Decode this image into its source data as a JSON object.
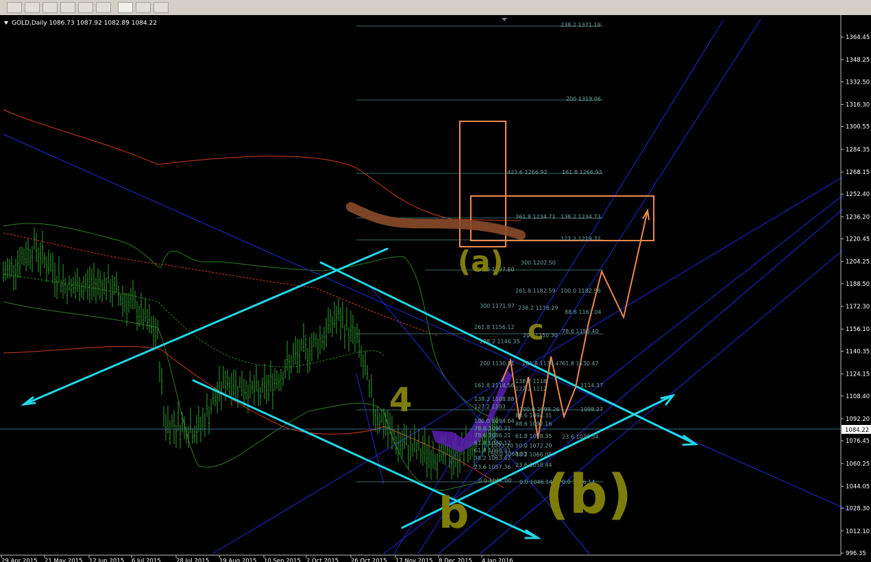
{
  "window": {
    "symbol_header": "GOLD,Daily  1086.73  1087.92  1082.89  1084.22"
  },
  "chart_data": {
    "type": "candlestick",
    "symbol": "GOLD",
    "timeframe": "Daily",
    "ohlc": {
      "open": 1086.73,
      "high": 1087.92,
      "low": 1082.89,
      "close": 1084.22
    },
    "current_price_label": "1084.22",
    "ylim": [
      996.35,
      1371.19
    ],
    "price_ticks": [
      "1364.45",
      "1348.25",
      "1332.50",
      "1316.30",
      "1300.55",
      "1284.35",
      "1268.15",
      "1252.40",
      "1236.20",
      "1220.45",
      "1204.25",
      "1188.50",
      "1172.30",
      "1156.10",
      "1140.35",
      "1124.15",
      "1108.40",
      "1092.20",
      "1076.45",
      "1060.25",
      "1044.05",
      "1028.30",
      "1012.10",
      "996.35"
    ],
    "date_ticks": [
      "29 Apr 2015",
      "21 May 2015",
      "12 Jun 2015",
      "6 Jul 2015",
      "28 Jul 2015",
      "19 Aug 2015",
      "10 Sep 2015",
      "2 Oct 2015",
      "26 Oct 2015",
      "17 Nov 2015",
      "8 Dec 2015",
      "4 Jan 2016"
    ],
    "fibonacci_labels": [
      "238.2 1371.19",
      "200 1319.06",
      "423.6 1266.92",
      "161.8 1266.93",
      "361.8 1234.71",
      "138.2 1234.73",
      "127.2 1219.72",
      "300 1202.50",
      "261.8 1197.60",
      "261.8 1182.59",
      "100.0 1182.56",
      "300 1171.97",
      "238.2 1176.29",
      "88.6 1167.04",
      "261.8 1156.12",
      "200 1150.30",
      "78.6 1153.40",
      "238.2 1146.35",
      "200 1130.51",
      "161.8 1130.47",
      "61.8 1130.47",
      "161.8 1114.56",
      "138.2 1118",
      "127.2 1112",
      "1114.37",
      "138.2 1108.88",
      "127.2 1103",
      "100.0 1098.26",
      "1098.27",
      "100.0 1094.04",
      "88.6 1094.31",
      "78.6 1090.31",
      "88.6 1092.16",
      "78.6 1086.21",
      "61.8 1078.35",
      "23.6 1078.34",
      "61.8 1080.12",
      "50.0 1072.20",
      "1073.20",
      "61.8 1068.31",
      "38.2 1066.05",
      "50.0 1068.31",
      "38.2 1063.42",
      "23.6 1058.44",
      "23.6 1057.36",
      "0.0 1047.00",
      "0.0 1046.14",
      "0.0 1046.14"
    ],
    "annotations": [
      "(a)",
      "c",
      "4",
      "(b)",
      "b"
    ],
    "colors": {
      "background": "#000000",
      "bars": "#2fa12f",
      "channel": "#22d8e8",
      "projection": "#f08a4b",
      "bollinger_outer": "#d23a1e",
      "bollinger_inner": "#2d7d1f",
      "trendlines": "#1d2bd6",
      "fib_text": "#3a6a6a",
      "handwriting": "#7f7d0a",
      "handwriting_brown": "#8a4a2a"
    },
    "grid": false
  }
}
